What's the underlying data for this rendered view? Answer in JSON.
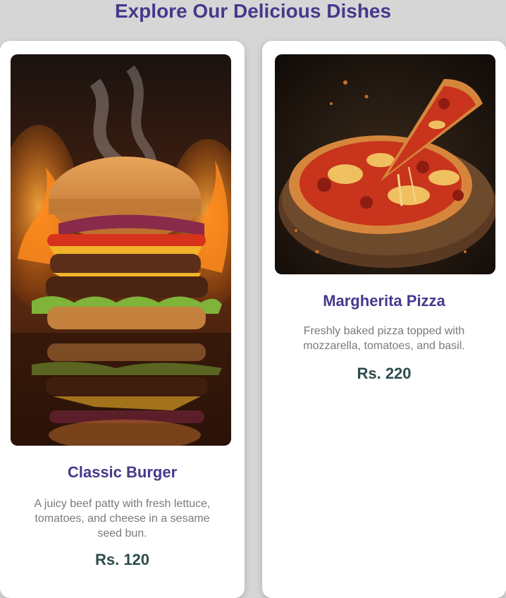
{
  "page": {
    "title": "Explore Our Delicious Dishes"
  },
  "dishes": [
    {
      "name": "Classic Burger",
      "description": "A juicy beef patty with fresh lettuce, tomatoes, and cheese in a sesame seed bun.",
      "price": "Rs. 120",
      "image": "burger-photo"
    },
    {
      "name": "Margherita Pizza",
      "description": "Freshly baked pizza topped with mozzarella, tomatoes, and basil.",
      "price": "Rs. 220",
      "image": "pizza-photo"
    }
  ],
  "colors": {
    "background": "#d6d6d6",
    "title": "#443a8c",
    "dish_name": "#443a8c",
    "description": "#7a7a7a",
    "price": "#2d4c4c",
    "card": "#ffffff"
  }
}
